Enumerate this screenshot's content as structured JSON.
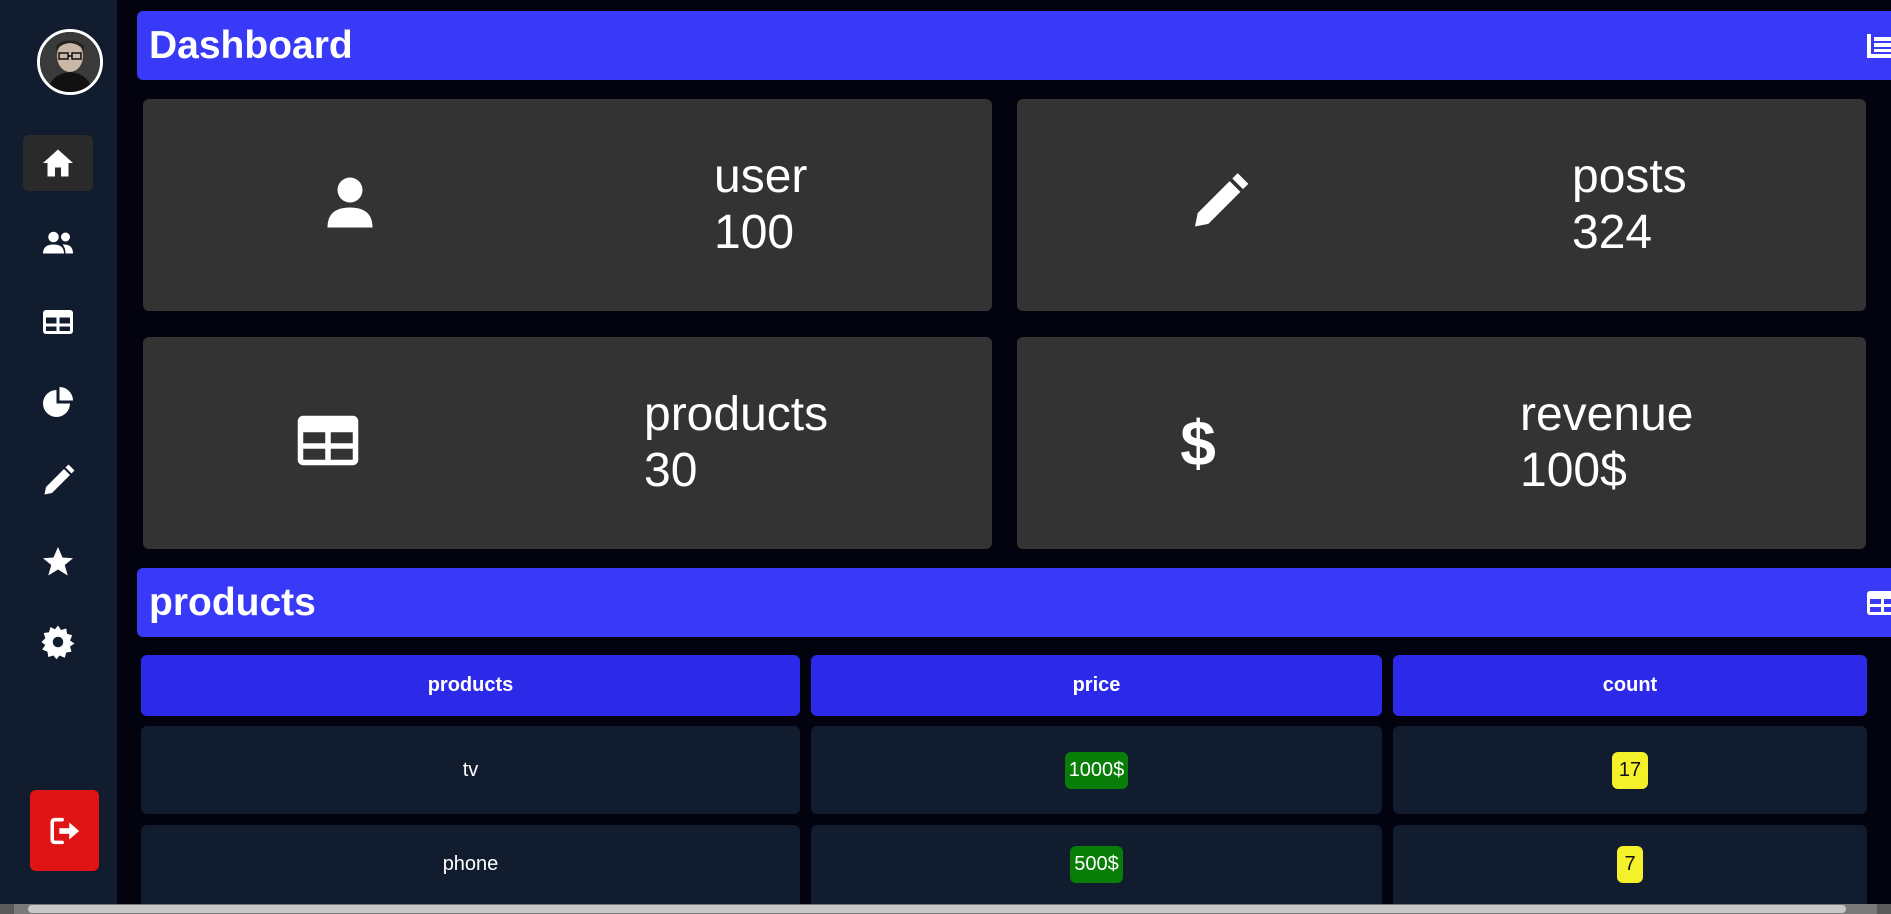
{
  "sidebar": {
    "avatar_icon": "user-avatar",
    "items": [
      {
        "icon": "home-icon",
        "active": true
      },
      {
        "icon": "users-icon",
        "active": false
      },
      {
        "icon": "table-icon",
        "active": false
      },
      {
        "icon": "pie-chart-icon",
        "active": false
      },
      {
        "icon": "pencil-icon",
        "active": false
      },
      {
        "icon": "star-icon",
        "active": false
      },
      {
        "icon": "gear-icon",
        "active": false
      }
    ],
    "logout_icon": "sign-out-icon"
  },
  "dashboard": {
    "title": "Dashboard",
    "icon": "list-chart-icon"
  },
  "stats": [
    {
      "label": "user",
      "value": "100",
      "icon": "user-icon"
    },
    {
      "label": "posts",
      "value": "324",
      "icon": "pencil-icon"
    },
    {
      "label": "products",
      "value": "30",
      "icon": "table-icon"
    },
    {
      "label": "revenue",
      "value": "100$",
      "icon": "dollar-icon"
    }
  ],
  "products_section": {
    "title": "products",
    "icon": "table-icon",
    "columns": [
      "products",
      "price",
      "count"
    ],
    "rows": [
      {
        "product": "tv",
        "price": "1000$",
        "count": "17"
      },
      {
        "product": "phone",
        "price": "500$",
        "count": "7"
      }
    ]
  },
  "colors": {
    "accent": "#383af7",
    "header_cell": "#2c2ae8",
    "card_bg": "#333333",
    "sidebar_bg": "#111d2e",
    "price_badge": "#087d08",
    "count_badge": "#f4f02a",
    "logout": "#e01414"
  }
}
